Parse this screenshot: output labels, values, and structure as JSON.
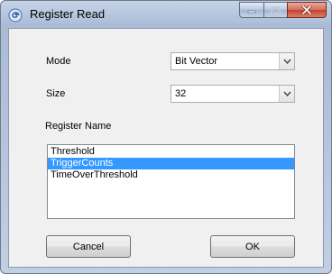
{
  "window": {
    "title": "Register Read",
    "icon": "spiral-app-icon",
    "caption_buttons": [
      "minimize",
      "maximize",
      "close"
    ]
  },
  "form": {
    "mode": {
      "label": "Mode",
      "value": "Bit Vector"
    },
    "size": {
      "label": "Size",
      "value": "32"
    },
    "register_name": {
      "label": "Register Name",
      "items": [
        "Threshold",
        "TriggerCounts",
        "TimeOverThreshold"
      ],
      "selected_index": 1
    }
  },
  "buttons": {
    "cancel": "Cancel",
    "ok": "OK"
  },
  "colors": {
    "selection": "#3399ff",
    "client_background": "#f0f0f0",
    "frame": "#aabbd6",
    "close_button": "#c4412b"
  }
}
